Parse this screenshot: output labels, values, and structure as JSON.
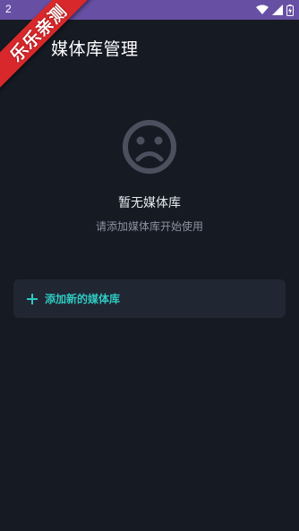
{
  "status_bar": {
    "time": "2",
    "icons": [
      "wifi-icon",
      "signal-icon",
      "battery-icon"
    ]
  },
  "watermark": {
    "text": "乐乐亲测"
  },
  "header": {
    "title": "媒体库管理"
  },
  "empty_state": {
    "icon": "sad-face-icon",
    "title": "暂无媒体库",
    "subtitle": "请添加媒体库开始使用"
  },
  "add_library": {
    "label": "添加新的媒体库",
    "icon": "plus-icon"
  },
  "colors": {
    "status_bar": "#6750a4",
    "background": "#161a23",
    "card": "#212633",
    "accent": "#2ec9c0",
    "ribbon": "#d8282b"
  }
}
